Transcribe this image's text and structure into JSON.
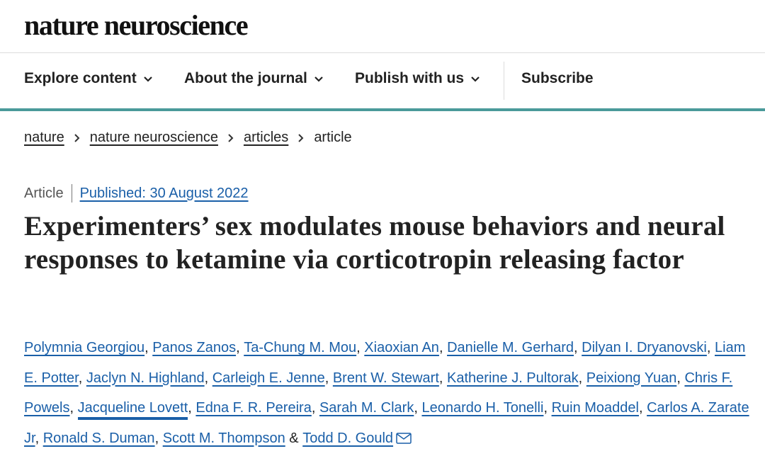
{
  "header": {
    "logo": "nature neuroscience"
  },
  "nav": {
    "items": [
      {
        "label": "Explore content",
        "icon": "chevron-down-icon"
      },
      {
        "label": "About the journal",
        "icon": "chevron-down-icon"
      },
      {
        "label": "Publish with us",
        "icon": "chevron-down-icon"
      }
    ],
    "subscribe": "Subscribe"
  },
  "breadcrumb": {
    "items": [
      "nature",
      "nature neuroscience",
      "articles"
    ],
    "current": "article",
    "separator_icon": "chevron-right-icon"
  },
  "article": {
    "type": "Article",
    "published": "Published: 30 August 2022",
    "title": "Experimenters’ sex modulates mouse behaviors and neural responses to ketamine via corticotropin releasing factor",
    "authors": [
      "Polymnia Georgiou",
      "Panos Zanos",
      "Ta-Chung M. Mou",
      "Xiaoxian An",
      "Danielle M. Gerhard",
      "Dilyan I. Dryanovski",
      "Liam E. Potter",
      "Jaclyn N. Highland",
      "Carleigh E. Jenne",
      "Brent W. Stewart",
      "Katherine J. Pultorak",
      "Peixiong Yuan",
      "Chris F. Powels",
      "Jacqueline Lovett",
      "Edna F. R. Pereira",
      "Sarah M. Clark",
      "Leonardo H. Tonelli",
      "Ruin Moaddel",
      "Carlos A. Zarate Jr",
      "Ronald S. Duman",
      "Scott M. Thompson",
      "Todd D. Gould"
    ],
    "author_separator": ",",
    "last_author_joiner": "&",
    "contact_icon": "mail-icon"
  },
  "colors": {
    "accent": "#4a9a9a",
    "link": "#1a5fa8",
    "text": "#222222"
  }
}
